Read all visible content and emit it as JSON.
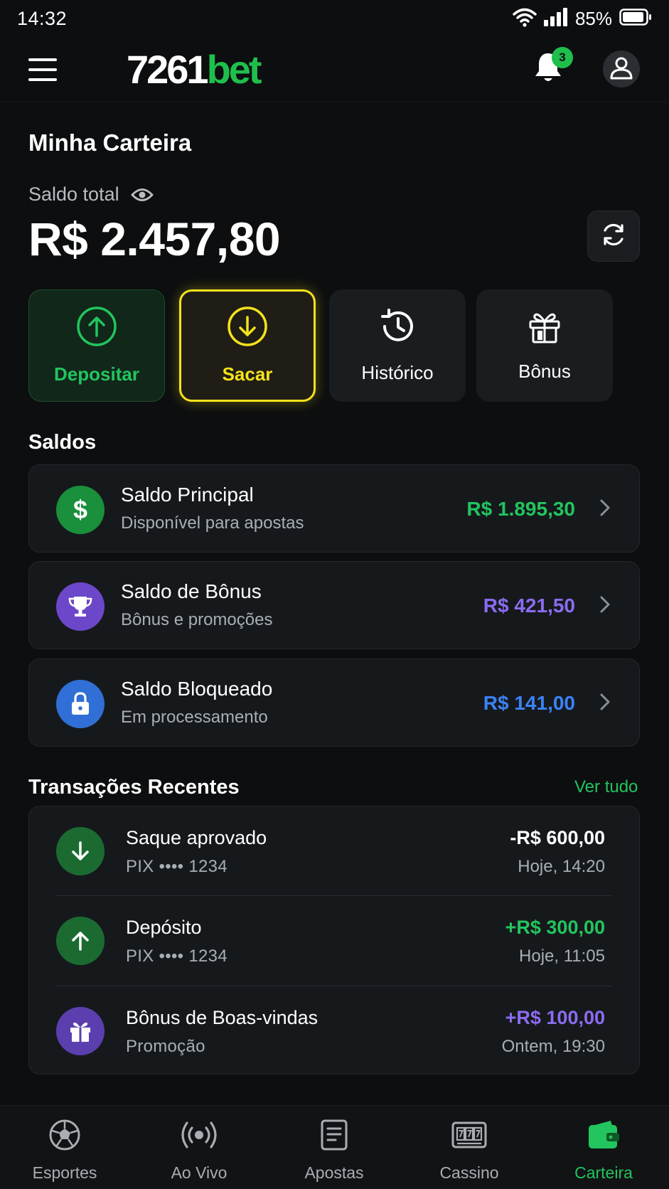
{
  "status_bar": {
    "time": "14:32",
    "battery": "85%"
  },
  "header": {
    "logo_number": "7261",
    "logo_suffix": "bet",
    "notifications_count": "3"
  },
  "wallet": {
    "title": "Minha Carteira",
    "total_label": "Saldo total",
    "total_value": "R$ 2.457,80"
  },
  "actions": {
    "deposit": "Depositar",
    "withdraw": "Sacar",
    "history": "Histórico",
    "bonus": "Bônus"
  },
  "balances": {
    "section_title": "Saldos",
    "items": [
      {
        "title": "Saldo Principal",
        "subtitle": "Disponível para apostas",
        "amount": "R$ 1.895,30",
        "color": "#22c55e",
        "icon": "dollar-icon"
      },
      {
        "title": "Saldo de Bônus",
        "subtitle": "Bônus e promoções",
        "amount": "R$ 421,50",
        "color": "#8b6cf0",
        "icon": "trophy-icon"
      },
      {
        "title": "Saldo Bloqueado",
        "subtitle": "Em processamento",
        "amount": "R$ 141,00",
        "color": "#3b82f6",
        "icon": "lock-icon"
      }
    ]
  },
  "transactions": {
    "section_title": "Transações Recentes",
    "see_all": "Ver tudo",
    "items": [
      {
        "title": "Saque aprovado",
        "subtitle": "PIX •••• 1234",
        "amount": "-R$ 600,00",
        "time": "Hoje, 14:20",
        "color": "#ffffff",
        "icon": "arrow-down-icon"
      },
      {
        "title": "Depósito",
        "subtitle": "PIX •••• 1234",
        "amount": "+R$ 300,00",
        "time": "Hoje, 11:05",
        "color": "#22c55e",
        "icon": "arrow-up-icon"
      },
      {
        "title": "Bônus de Boas-vindas",
        "subtitle": "Promoção",
        "amount": "+R$ 100,00",
        "time": "Ontem, 19:30",
        "color": "#8b6cf0",
        "icon": "gift-icon"
      }
    ]
  },
  "bottom_nav": {
    "items": [
      {
        "label": "Esportes",
        "icon": "soccer-ball-icon"
      },
      {
        "label": "Ao Vivo",
        "icon": "live-broadcast-icon"
      },
      {
        "label": "Apostas",
        "icon": "bet-slip-icon"
      },
      {
        "label": "Cassino",
        "icon": "slot-machine-icon"
      },
      {
        "label": "Carteira",
        "icon": "wallet-icon",
        "active": true
      }
    ]
  },
  "colors": {
    "accent": "#22c55e",
    "highlight": "#f5e21b",
    "bonus": "#8b6cf0",
    "blocked": "#3b82f6",
    "background": "#0c0e10"
  }
}
